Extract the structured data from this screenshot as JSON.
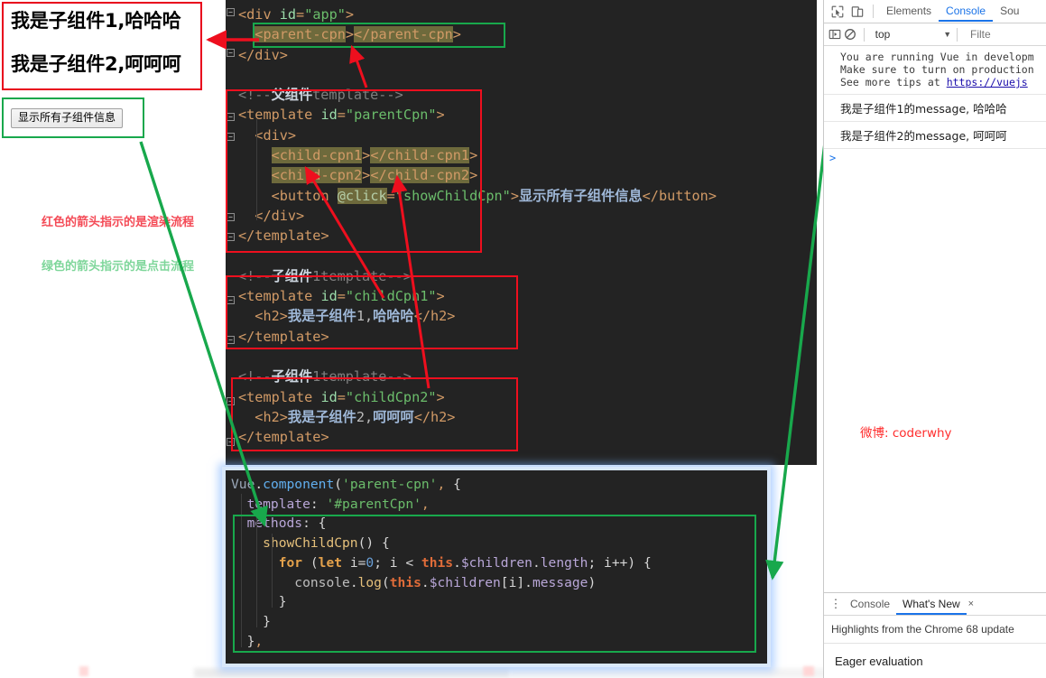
{
  "render_output": {
    "heading1": "我是子组件1,哈哈哈",
    "heading2": "我是子组件2,呵呵呵",
    "button_label": "显示所有子组件信息"
  },
  "legend": {
    "red": "红色的箭头指示的是渲染流程",
    "green": "绿色的箭头指示的是点击流程"
  },
  "watermark": "微博: coderwhy",
  "html_code": {
    "l01": "<div id=\"app\">",
    "l02": "  <parent-cpn></parent-cpn>",
    "l03": "</div>",
    "l04": "",
    "l05": "<!--父组件template-->",
    "l06": "<template id=\"parentCpn\">",
    "l07": "  <div>",
    "l08": "    <child-cpn1></child-cpn1>",
    "l09": "    <child-cpn2></child-cpn2>",
    "l10": "    <button @click=\"showChildCpn\">显示所有子组件信息</button>",
    "l11": "  </div>",
    "l12": "</template>",
    "l13": "",
    "l14": "<!--子组件1template-->",
    "l15": "<template id=\"childCpn1\">",
    "l16": "  <h2>我是子组件1,哈哈哈</h2>",
    "l17": "</template>",
    "l18": "",
    "l19": "<!--子组件1template-->",
    "l20": "<template id=\"childCpn2\">",
    "l21": "  <h2>我是子组件2,呵呵呵</h2>",
    "l22": "</template>"
  },
  "js_code": {
    "l01": "Vue.component('parent-cpn', {",
    "l02": "  template: '#parentCpn',",
    "l03": "  methods: {",
    "l04": "    showChildCpn() {",
    "l05": "      for (let i=0; i < this.$children.length; i++) {",
    "l06": "        console.log(this.$children[i].message)",
    "l07": "      }",
    "l08": "    }",
    "l09": "  },"
  },
  "devtools": {
    "tabs": [
      {
        "label": "Elements",
        "active": false
      },
      {
        "label": "Console",
        "active": true
      },
      {
        "label": "Sou",
        "active": false
      }
    ],
    "icons": {
      "inspect": "inspect-element-icon",
      "device": "device-toolbar-icon",
      "sidebar": "console-sidebar-icon",
      "clear": "clear-console-icon"
    },
    "context": "top",
    "filter_placeholder": "Filte",
    "console_messages": [
      {
        "type": "warning",
        "lines": [
          "You are running Vue in developm",
          "Make sure to turn on production",
          "See more tips at "
        ],
        "link": "https://vuejs"
      },
      {
        "type": "log",
        "text": "我是子组件1的message, 哈哈哈"
      },
      {
        "type": "log",
        "text": "我是子组件2的message, 呵呵呵"
      }
    ],
    "prompt": ">",
    "drawer": {
      "tabs": [
        {
          "label": "Console",
          "active": false
        },
        {
          "label": "What's New",
          "active": true
        }
      ],
      "close": "×",
      "subtitle": "Highlights from the Chrome 68 update",
      "item": "Eager evaluation"
    }
  },
  "colors": {
    "annotation_red": "#ee0f1e",
    "annotation_green": "#18a84c",
    "editor_bg": "#232323",
    "devtools_accent": "#1a73e8"
  }
}
